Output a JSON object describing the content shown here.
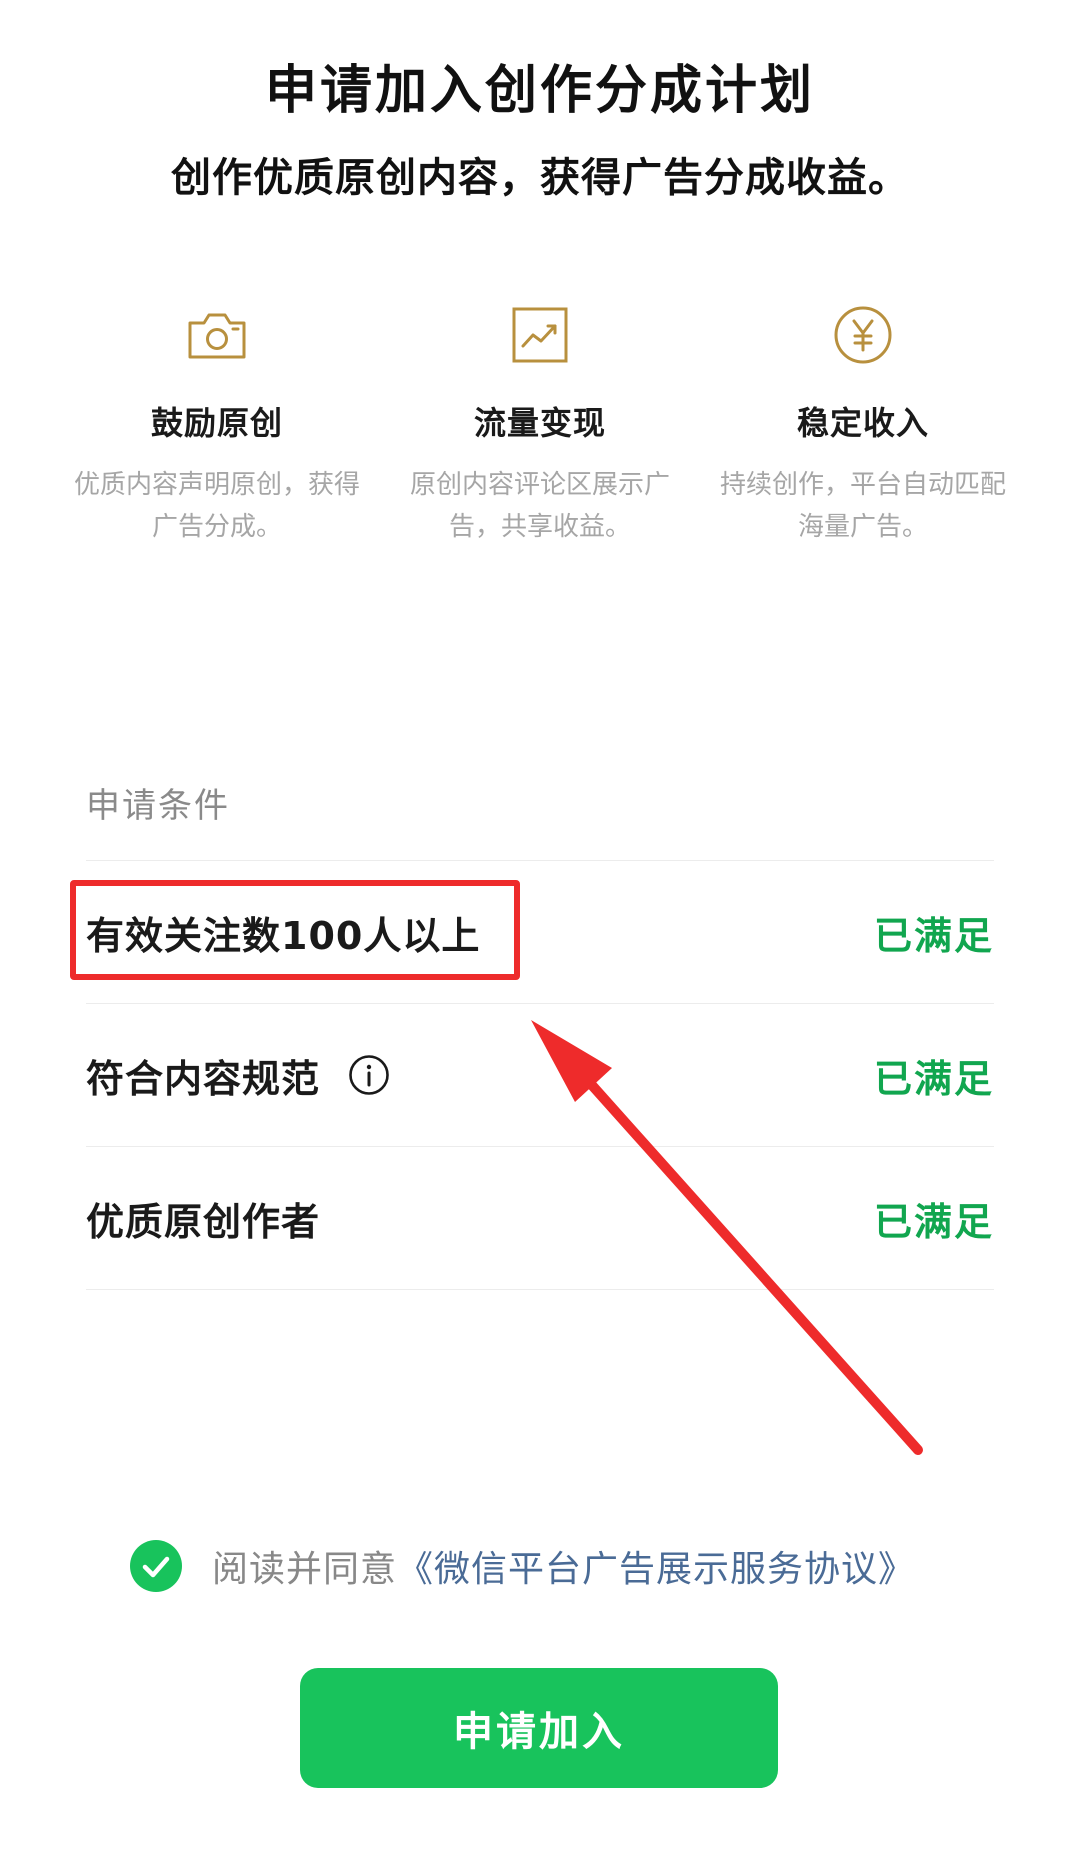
{
  "header": {
    "title": "申请加入创作分成计划",
    "subtitle": "创作优质原创内容，获得广告分成收益。"
  },
  "features": [
    {
      "icon": "camera-icon",
      "title": "鼓励原创",
      "desc": "优质内容声明原创，获得广告分成。"
    },
    {
      "icon": "trend-chart-icon",
      "title": "流量变现",
      "desc": "原创内容评论区展示广告，共享收益。"
    },
    {
      "icon": "yuan-coin-icon",
      "title": "稳定收入",
      "desc": "持续创作，平台自动匹配海量广告。"
    }
  ],
  "conditions": {
    "label": "申请条件",
    "items": [
      {
        "name": "有效关注数100人以上",
        "status": "已满足"
      },
      {
        "name": "符合内容规范",
        "status": "已满足",
        "has_info": true
      },
      {
        "name": "优质原创作者",
        "status": "已满足"
      }
    ]
  },
  "agreement": {
    "checked": true,
    "text": "阅读并同意",
    "link": "《微信平台广告展示服务协议》"
  },
  "apply_button": {
    "label": "申请加入"
  },
  "colors": {
    "accent_gold": "#b8903e",
    "status_green": "#11a64f",
    "button_green": "#18c35c",
    "link_blue": "#4a6b96",
    "annotation_red": "#ee2b2b"
  }
}
